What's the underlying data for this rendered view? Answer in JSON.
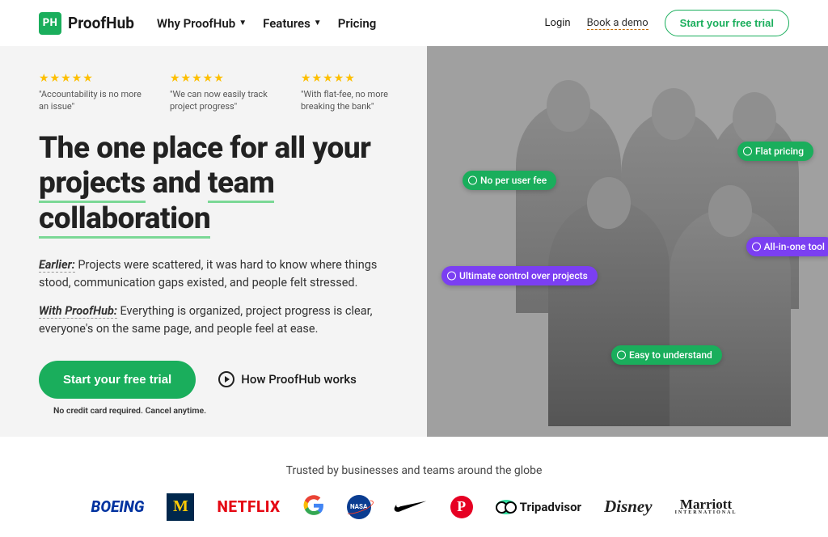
{
  "brand": {
    "mark": "PH",
    "name": "ProofHub"
  },
  "nav": {
    "why": "Why ProofHub",
    "features": "Features",
    "pricing": "Pricing"
  },
  "header_links": {
    "login": "Login",
    "demo": "Book a demo",
    "trial": "Start your free trial"
  },
  "reviews": [
    {
      "quote": "\"Accountability is no more an issue\""
    },
    {
      "quote": "\"We can now easily track project progress\""
    },
    {
      "quote": "\"With flat-fee, no more breaking the bank\""
    }
  ],
  "headline": {
    "l1a": "The one place for all your ",
    "u1": "projects",
    "l1b": " and ",
    "u2": "team collaboration"
  },
  "para1": {
    "label": "Earlier:",
    "text": " Projects were scattered, it was hard to know where things stood, communication gaps existed, and people felt stressed."
  },
  "para2": {
    "label": "With ProofHub:",
    "text": " Everything is organized, project progress is clear, everyone's on the same page, and people feel at ease."
  },
  "cta": {
    "trial": "Start your free trial",
    "how": "How ProofHub works",
    "fine": "No credit card required. Cancel anytime."
  },
  "pills": {
    "flat": "Flat pricing",
    "nofee": "No per user fee",
    "allinone": "All-in-one tool",
    "control": "Ultimate control over projects",
    "easy": "Easy to understand"
  },
  "trusted_label": "Trusted by businesses and teams around the globe",
  "logos": {
    "boeing": "BOEING",
    "michigan": "M",
    "netflix": "NETFLIX",
    "nasa": "NASA",
    "tripadvisor": "Tripadvisor",
    "disney": "Disney",
    "marriott": "Marriott",
    "marriott_sub": "INTERNATIONAL"
  }
}
